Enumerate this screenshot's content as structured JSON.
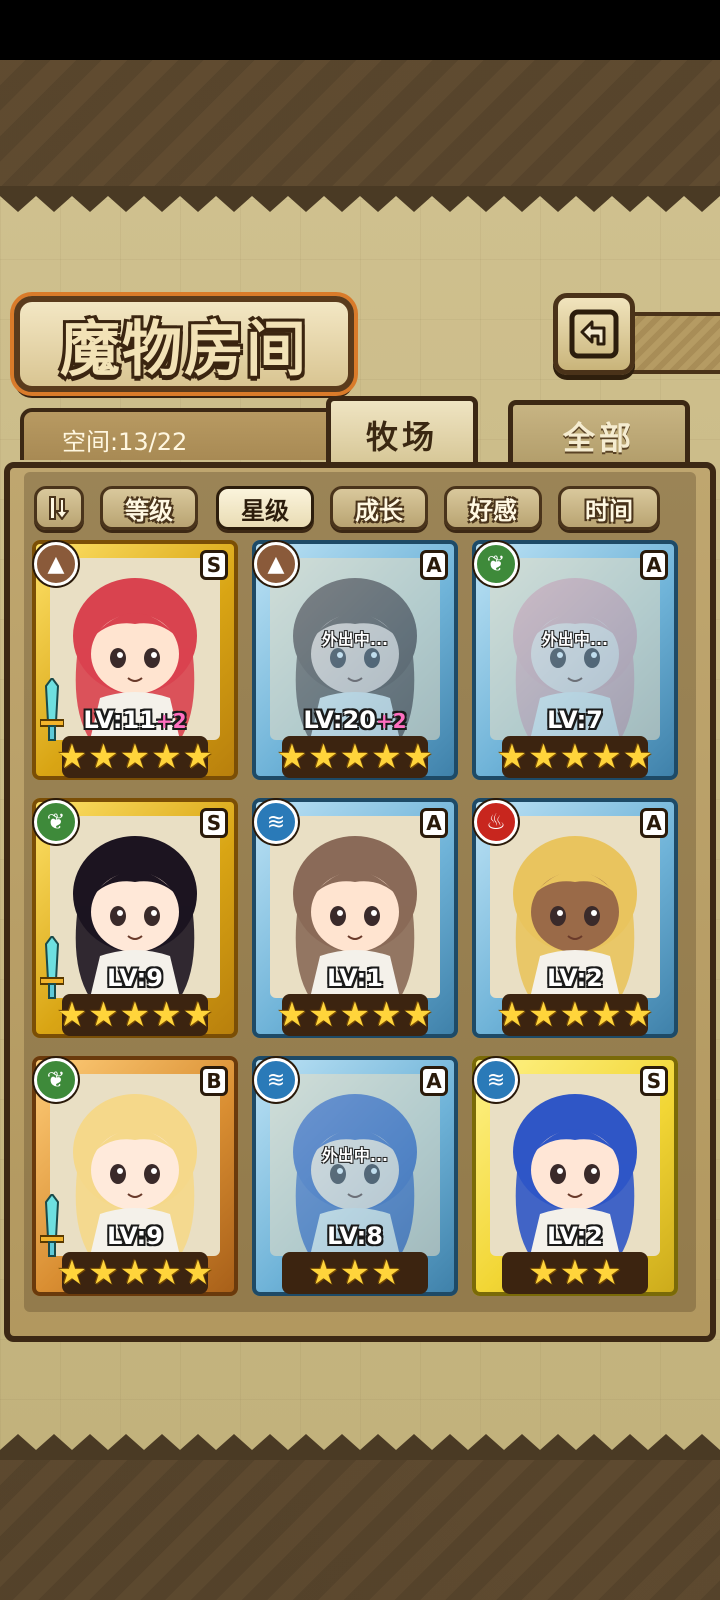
{
  "header": {
    "title": "魔物房间",
    "back_icon": "back-arrow-icon"
  },
  "space": {
    "label": "空间:13/22"
  },
  "tabs": [
    {
      "label": "牧场",
      "active": true
    },
    {
      "label": "全部",
      "active": false
    }
  ],
  "sort": {
    "toggle_icon": "sort-order-icon",
    "options": [
      {
        "label": "等级",
        "active": false
      },
      {
        "label": "星级",
        "active": true
      },
      {
        "label": "成长",
        "active": false
      },
      {
        "label": "好感",
        "active": false
      },
      {
        "label": "时间",
        "active": false
      }
    ]
  },
  "monsters": [
    {
      "level": "LV:11",
      "bonus": "+2",
      "rank": "S",
      "stars": 5,
      "element": "earth",
      "frame": "gold",
      "status": "",
      "hair": "#d9434f",
      "skin": "#ffe4d0",
      "weapon": true
    },
    {
      "level": "LV:20",
      "bonus": "+2",
      "rank": "A",
      "stars": 5,
      "element": "earth",
      "frame": "blue",
      "status": "外出中...",
      "hair": "#5a3d30",
      "skin": "#f5d2c0",
      "weapon": false
    },
    {
      "level": "LV:7",
      "bonus": "",
      "rank": "A",
      "stars": 5,
      "element": "wind",
      "frame": "blue",
      "status": "外出中...",
      "hair": "#e8a6a6",
      "skin": "#f8e0d6",
      "weapon": false
    },
    {
      "level": "LV:9",
      "bonus": "",
      "rank": "S",
      "stars": 5,
      "element": "wind",
      "frame": "gold",
      "status": "",
      "hair": "#1c1420",
      "skin": "#ffe8d8",
      "weapon": true
    },
    {
      "level": "LV:1",
      "bonus": "",
      "rank": "A",
      "stars": 5,
      "element": "water",
      "frame": "blue",
      "status": "",
      "hair": "#8a6a58",
      "skin": "#ffe4d0",
      "weapon": false
    },
    {
      "level": "LV:2",
      "bonus": "",
      "rank": "A",
      "stars": 5,
      "element": "fire",
      "frame": "blue",
      "status": "",
      "hair": "#e9c45e",
      "skin": "#9a6a48",
      "weapon": false
    },
    {
      "level": "LV:9",
      "bonus": "",
      "rank": "B",
      "stars": 5,
      "element": "wind",
      "frame": "bronze",
      "status": "",
      "hair": "#f5d88a",
      "skin": "#ffeadb",
      "weapon": true
    },
    {
      "level": "LV:8",
      "bonus": "",
      "rank": "A",
      "stars": 3,
      "element": "water",
      "frame": "blue",
      "status": "外出中...",
      "hair": "#3b5fb8",
      "skin": "#ffe6d6",
      "weapon": false
    },
    {
      "level": "LV:2",
      "bonus": "",
      "rank": "S",
      "stars": 3,
      "element": "water",
      "frame": "yellow",
      "status": "",
      "hair": "#2f56c6",
      "skin": "#ffe6d6",
      "weapon": false
    }
  ],
  "colors": {
    "earth": "#8a5a3a",
    "wind": "#3e8a3a",
    "water": "#2a7ab8",
    "fire": "#c8261e"
  }
}
